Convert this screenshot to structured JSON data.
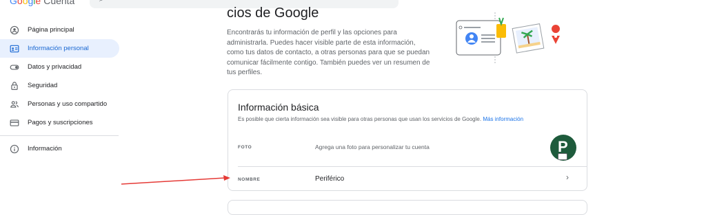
{
  "header": {
    "logo_parts": [
      "G",
      "o",
      "o",
      "g",
      "l",
      "e"
    ],
    "product": "Cuenta",
    "search_icon": "search-icon"
  },
  "sidebar": {
    "items": [
      {
        "label": "Página principal",
        "icon": "account-circle-icon",
        "active": false
      },
      {
        "label": "Información personal",
        "icon": "id-card-icon",
        "active": true
      },
      {
        "label": "Datos y privacidad",
        "icon": "toggle-icon",
        "active": false
      },
      {
        "label": "Seguridad",
        "icon": "lock-icon",
        "active": false
      },
      {
        "label": "Personas y uso compartido",
        "icon": "people-icon",
        "active": false
      },
      {
        "label": "Pagos y suscripciones",
        "icon": "credit-card-icon",
        "active": false
      }
    ],
    "info_item": {
      "label": "Información",
      "icon": "info-icon"
    }
  },
  "main": {
    "title": "cios de Google",
    "intro": "Encontrarás tu información de perfil y las opciones para administrarla. Puedes hacer visible parte de esta información, como tus datos de contacto, a otras personas para que se puedan comunicar fácilmente contigo. También puedes ver un resumen de tus perfiles."
  },
  "basic_info": {
    "title": "Información básica",
    "desc": "Es posible que cierta información sea visible para otras personas que usan los servicios de Google.",
    "more_link": "Más información",
    "photo_label": "FOTO",
    "photo_hint": "Agrega una foto para personalizar tu cuenta",
    "avatar_letter": "P",
    "name_label": "NOMBRE",
    "name_value": "Periférico"
  },
  "colors": {
    "accent": "#1a73e8",
    "active_bg": "#e8f0fe",
    "arrow": "#e53935",
    "avatar_bg": "#1e5b3c"
  }
}
